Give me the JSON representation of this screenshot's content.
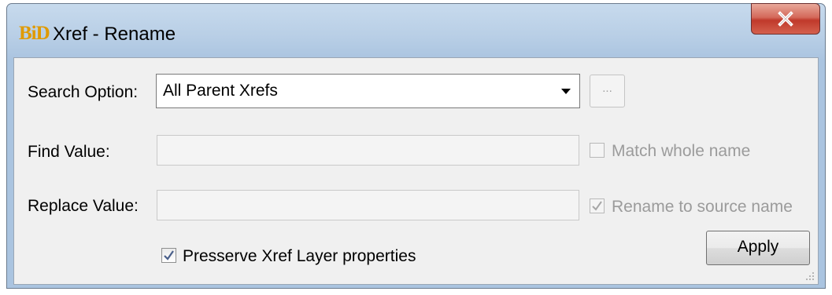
{
  "window": {
    "title": "Xref - Rename",
    "icon": "BiD"
  },
  "search": {
    "label": "Search Option:",
    "selected": "All Parent Xrefs",
    "browse_label": "..."
  },
  "find": {
    "label": "Find Value:",
    "value": "",
    "match_whole_name_label": "Match whole name",
    "match_whole_name_checked": false
  },
  "replace": {
    "label": "Replace Value:",
    "value": "",
    "rename_to_source_label": "Rename to source name",
    "rename_to_source_checked": true
  },
  "preserve": {
    "label": "Presserve Xref Layer properties",
    "checked": true
  },
  "apply_label": "Apply",
  "colors": {
    "title_bar": "#b9d1ea",
    "close_button": "#c75050",
    "client_bg": "#f0f0f0",
    "check_mark": "#4a5f8a",
    "disabled_text": "#9b9b9b"
  }
}
